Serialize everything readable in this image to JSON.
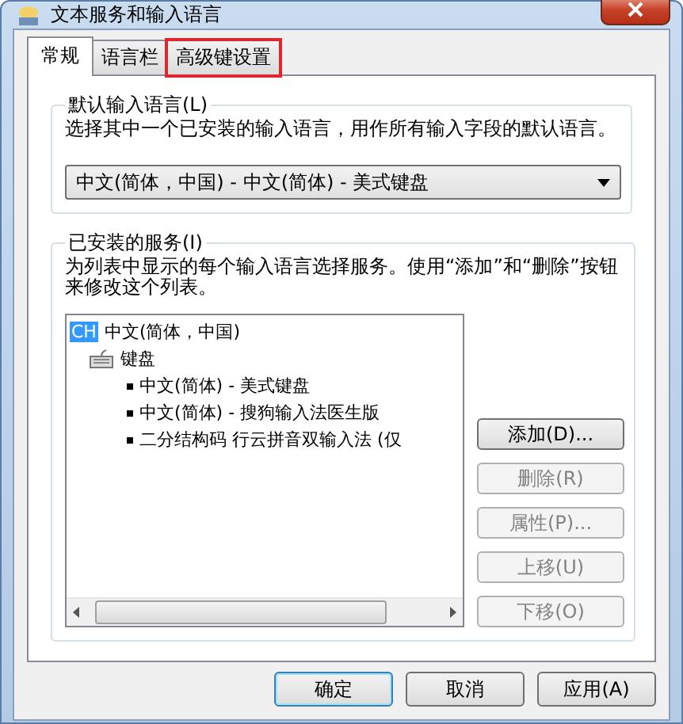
{
  "window": {
    "title": "文本服务和输入语言"
  },
  "tabs": [
    {
      "label": "常规",
      "selected": true,
      "highlighted": false
    },
    {
      "label": "语言栏",
      "selected": false,
      "highlighted": false
    },
    {
      "label": "高级键设置",
      "selected": false,
      "highlighted": true
    }
  ],
  "default_language": {
    "legend": "默认输入语言(L)",
    "description": "选择其中一个已安装的输入语言，用作所有输入字段的默认语言。",
    "value": "中文(简体，中国) - 中文(简体) - 美式键盘"
  },
  "installed_services": {
    "legend": "已安装的服务(I)",
    "description": "为列表中显示的每个输入语言选择服务。使用“添加”和“删除”按钮来修改这个列表。",
    "tree": [
      {
        "badge": "CH",
        "label": "中文(简体，中国)",
        "kind": "language",
        "children": [
          {
            "label": "键盘",
            "kind": "category",
            "children": [
              {
                "label": "中文(简体) - 美式键盘",
                "kind": "service"
              },
              {
                "label": "中文(简体) - 搜狗输入法医生版",
                "kind": "service"
              },
              {
                "label": "二分结构码 行云拼音双输入法 (仅",
                "kind": "service"
              }
            ]
          }
        ]
      }
    ],
    "buttons": [
      {
        "label": "添加(D)...",
        "disabled": false
      },
      {
        "label": "删除(R)",
        "disabled": true
      },
      {
        "label": "属性(P)...",
        "disabled": true
      },
      {
        "label": "上移(U)",
        "disabled": true
      },
      {
        "label": "下移(O)",
        "disabled": true
      }
    ]
  },
  "footer_buttons": [
    {
      "label": "确定",
      "default": true
    },
    {
      "label": "取消",
      "default": false
    },
    {
      "label": "应用(A)",
      "default": false
    }
  ]
}
